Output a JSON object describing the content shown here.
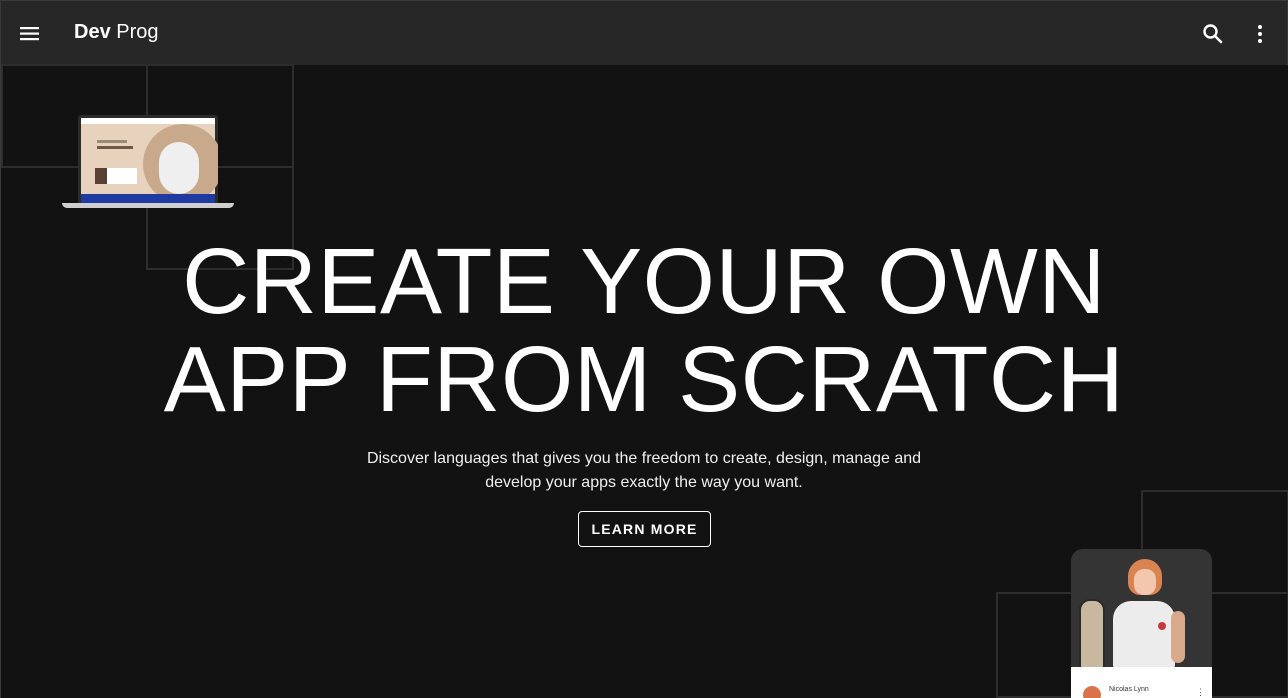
{
  "appbar": {
    "brand_bold": "Dev",
    "brand_rest": "Prog",
    "menu_icon": "menu-icon",
    "search_icon": "search-icon",
    "more_icon": "more-vert-icon"
  },
  "hero": {
    "headline_line1": "CREATE YOUR OWN",
    "headline_line2": "APP FROM SCRATCH",
    "subtitle_line1": "Discover languages that gives you the freedom to create, design, manage and",
    "subtitle_line2": "develop your apps exactly the way you want.",
    "cta_label": "LEARN MORE"
  },
  "phone_card": {
    "name": "Nicolas Lynn"
  },
  "colors": {
    "background": "#121212",
    "appbar": "#272727",
    "text": "#ffffff"
  }
}
